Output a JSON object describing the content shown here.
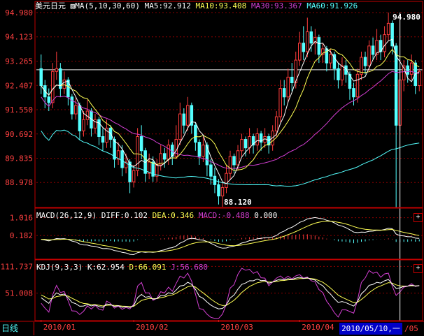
{
  "header": {
    "symbol": "美元日元",
    "ma_label": "MA(5,10,30,60)",
    "ma5": "MA5:92.912",
    "ma10": "MA10:93.408",
    "ma30": "MA30:93.367",
    "ma60": "MA60:91.926"
  },
  "macd": {
    "label": "MACD(26,12,9)",
    "diff": "DIFF:0.102",
    "dea": "DEA:0.346",
    "macd": "MACD:-0.488",
    "zero": "0.000"
  },
  "kdj": {
    "label": "KDJ(9,3,3)",
    "k": "K:62.954",
    "d": "D:66.091",
    "j": "J:56.680"
  },
  "footer": {
    "period_tab": "日线",
    "cursor_date": "2010/05/10,一",
    "partial_label": "/05"
  },
  "colors": {
    "bg": "#000000",
    "grid": "#8b0000",
    "up": "#ff3c3c",
    "down": "#54ffff",
    "ma5": "#ffffff",
    "ma10": "#ffff54",
    "ma30": "#d33fd3",
    "ma60": "#54ffff",
    "axis_text": "#ff4040"
  },
  "chart_data": [
    {
      "type": "candlestick",
      "title": "美元日元",
      "y_ticks": [
        "94.980",
        "94.123",
        "93.265",
        "92.407",
        "91.550",
        "90.692",
        "89.835",
        "88.978"
      ],
      "ylim": [
        88.12,
        94.98
      ],
      "max_label": "94.980",
      "min_label": "88.120",
      "reference_line": 92.96,
      "x_ticks": [
        "2010/01",
        "2010/02",
        "2010/03",
        "2010/04"
      ],
      "candles": [
        [
          93.0,
          92.4,
          93.5,
          92.1
        ],
        [
          92.4,
          92.0,
          92.6,
          91.6
        ],
        [
          92.0,
          91.8,
          92.3,
          91.5
        ],
        [
          91.8,
          92.9,
          93.2,
          91.6
        ],
        [
          92.9,
          93.0,
          93.6,
          92.6
        ],
        [
          93.0,
          92.3,
          93.2,
          92.0
        ],
        [
          92.3,
          92.6,
          92.9,
          92.1
        ],
        [
          92.6,
          92.0,
          92.7,
          91.7
        ],
        [
          92.0,
          91.4,
          92.1,
          91.2
        ],
        [
          91.4,
          91.7,
          92.0,
          91.2
        ],
        [
          91.7,
          90.8,
          91.8,
          90.5
        ],
        [
          90.8,
          91.2,
          91.5,
          90.6
        ],
        [
          91.2,
          91.5,
          91.9,
          91.0
        ],
        [
          91.5,
          90.9,
          91.6,
          90.6
        ],
        [
          90.9,
          91.2,
          91.4,
          90.7
        ],
        [
          91.2,
          90.6,
          91.3,
          90.3
        ],
        [
          90.6,
          90.4,
          90.9,
          90.1
        ],
        [
          90.4,
          90.9,
          91.2,
          90.2
        ],
        [
          90.9,
          90.5,
          91.0,
          90.2
        ],
        [
          90.5,
          89.8,
          90.6,
          89.5
        ],
        [
          89.8,
          90.1,
          90.4,
          89.6
        ],
        [
          90.1,
          89.5,
          90.3,
          89.2
        ],
        [
          89.5,
          89.7,
          90.0,
          89.3
        ],
        [
          89.7,
          89.0,
          89.8,
          88.6
        ],
        [
          89.0,
          89.4,
          89.6,
          88.8
        ],
        [
          89.4,
          90.6,
          90.9,
          89.2
        ],
        [
          90.6,
          90.1,
          91.0,
          89.8
        ],
        [
          90.1,
          89.3,
          90.2,
          89.0
        ],
        [
          89.3,
          89.7,
          90.0,
          89.1
        ],
        [
          89.7,
          89.2,
          89.9,
          89.0
        ],
        [
          89.2,
          89.6,
          89.8,
          89.0
        ],
        [
          89.6,
          90.0,
          90.3,
          89.4
        ],
        [
          90.0,
          89.8,
          90.2,
          89.5
        ],
        [
          89.8,
          90.3,
          90.5,
          89.6
        ],
        [
          90.3,
          89.9,
          90.4,
          89.6
        ],
        [
          89.9,
          90.5,
          91.0,
          89.8
        ],
        [
          90.5,
          91.4,
          91.8,
          90.3
        ],
        [
          91.4,
          91.0,
          91.6,
          90.7
        ],
        [
          91.0,
          91.7,
          92.0,
          90.8
        ],
        [
          91.7,
          91.0,
          91.8,
          90.7
        ],
        [
          91.0,
          90.4,
          91.1,
          90.1
        ],
        [
          90.4,
          89.9,
          90.5,
          89.6
        ],
        [
          89.9,
          90.3,
          90.6,
          89.7
        ],
        [
          90.3,
          89.6,
          90.4,
          89.2
        ],
        [
          89.6,
          89.2,
          89.8,
          88.9
        ],
        [
          89.2,
          88.9,
          89.5,
          88.6
        ],
        [
          88.9,
          88.5,
          89.1,
          88.2
        ],
        [
          88.5,
          88.8,
          89.0,
          88.12
        ],
        [
          88.8,
          89.3,
          89.6,
          88.6
        ],
        [
          89.3,
          89.9,
          90.1,
          89.1
        ],
        [
          89.9,
          89.6,
          90.0,
          89.3
        ],
        [
          89.6,
          90.1,
          90.3,
          89.4
        ],
        [
          90.1,
          90.5,
          90.7,
          89.9
        ],
        [
          90.5,
          90.2,
          90.6,
          89.9
        ],
        [
          90.2,
          90.6,
          90.9,
          90.0
        ],
        [
          90.6,
          90.3,
          90.7,
          90.0
        ],
        [
          90.3,
          90.7,
          90.9,
          90.1
        ],
        [
          90.7,
          90.4,
          90.8,
          90.1
        ],
        [
          90.4,
          90.6,
          90.9,
          90.2
        ],
        [
          90.6,
          90.3,
          90.7,
          90.0
        ],
        [
          90.3,
          90.8,
          91.0,
          90.1
        ],
        [
          90.8,
          91.3,
          91.5,
          90.6
        ],
        [
          91.3,
          92.3,
          92.6,
          91.1
        ],
        [
          92.3,
          92.0,
          92.6,
          91.7
        ],
        [
          92.0,
          92.7,
          93.0,
          91.8
        ],
        [
          92.7,
          92.5,
          93.2,
          92.2
        ],
        [
          92.5,
          93.3,
          93.6,
          92.3
        ],
        [
          93.3,
          93.9,
          94.3,
          93.1
        ],
        [
          93.9,
          93.6,
          94.5,
          93.3
        ],
        [
          93.6,
          94.3,
          94.8,
          93.4
        ],
        [
          94.3,
          93.9,
          94.5,
          93.6
        ],
        [
          93.9,
          94.1,
          94.4,
          93.5
        ],
        [
          94.1,
          93.5,
          94.2,
          93.2
        ],
        [
          93.5,
          93.7,
          93.9,
          93.2
        ],
        [
          93.7,
          93.2,
          93.8,
          92.9
        ],
        [
          93.2,
          93.5,
          93.7,
          93.0
        ],
        [
          93.5,
          93.0,
          93.6,
          92.6
        ],
        [
          93.0,
          92.6,
          93.2,
          92.3
        ],
        [
          92.6,
          93.1,
          93.4,
          92.4
        ],
        [
          93.1,
          92.8,
          93.3,
          92.5
        ],
        [
          92.8,
          92.3,
          92.9,
          91.9
        ],
        [
          92.3,
          92.0,
          92.5,
          91.7
        ],
        [
          92.0,
          92.8,
          93.0,
          91.8
        ],
        [
          92.8,
          93.4,
          93.6,
          92.6
        ],
        [
          93.4,
          93.1,
          93.6,
          92.8
        ],
        [
          93.1,
          93.8,
          94.0,
          92.9
        ],
        [
          93.8,
          93.5,
          94.1,
          93.3
        ],
        [
          93.5,
          94.0,
          94.4,
          93.3
        ],
        [
          94.0,
          93.6,
          94.2,
          93.3
        ],
        [
          93.6,
          94.2,
          94.5,
          93.4
        ],
        [
          94.2,
          94.6,
          94.98,
          94.0
        ],
        [
          94.6,
          93.8,
          94.7,
          93.5
        ],
        [
          93.8,
          91.0,
          93.9,
          88.1
        ],
        [
          91.0,
          92.6,
          92.9,
          90.8
        ],
        [
          92.6,
          93.1,
          93.3,
          92.2
        ],
        [
          93.1,
          92.8,
          93.3,
          92.5
        ],
        [
          92.8,
          93.2,
          93.5,
          92.6
        ],
        [
          93.2,
          92.4,
          93.3,
          92.1
        ],
        [
          92.4,
          92.9,
          93.0,
          92.2
        ]
      ]
    },
    {
      "type": "bar",
      "title": "MACD(26,12,9)",
      "y_ticks": [
        "1.016",
        "0.182"
      ],
      "ylim": [
        -0.9,
        1.4
      ]
    },
    {
      "type": "line",
      "title": "KDJ(9,3,3)",
      "y_ticks": [
        "111.737",
        "51.008"
      ],
      "ylim": [
        -10,
        125
      ]
    }
  ]
}
